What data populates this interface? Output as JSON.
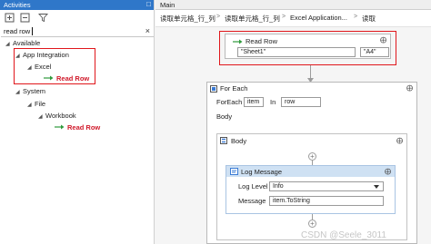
{
  "activities": {
    "title": "Activities",
    "pin_glyph": "□",
    "search": {
      "value": "read row",
      "clear_glyph": "×"
    },
    "tree": {
      "available": "Available",
      "app_integration": "App Integration",
      "excel": "Excel",
      "read_row_1": "Read Row",
      "system": "System",
      "file": "File",
      "workbook": "Workbook",
      "read_row_2": "Read Row"
    },
    "expanded_glyph": "◢",
    "collapsed_glyph": "▷"
  },
  "designer": {
    "tab": "Main",
    "breadcrumb": [
      "读取单元格_行_列",
      "读取单元格_行_列",
      "Excel Application...",
      "读取"
    ],
    "breadcrumb_sep": ">",
    "collapse_glyph": "⨁",
    "read_row": {
      "title": "Read Row",
      "sheet": "\"Sheet1\"",
      "cell": "\"A4\""
    },
    "for_each": {
      "title": "For Each",
      "foreach_label": "ForEach",
      "item_value": "item",
      "in_label": "In",
      "in_value": "row",
      "body_label": "Body"
    },
    "body_seq": {
      "title": "Body"
    },
    "log_message": {
      "title": "Log Message",
      "level_label": "Log Level",
      "level_value": "Info",
      "message_label": "Message",
      "message_value": "item.ToString"
    },
    "plus_glyph": "+"
  },
  "watermark": "CSDN @Seele_3011",
  "colors": {
    "accent": "#2f77c9",
    "highlight": "#e0161b",
    "log_header": "#cfe1f3"
  }
}
